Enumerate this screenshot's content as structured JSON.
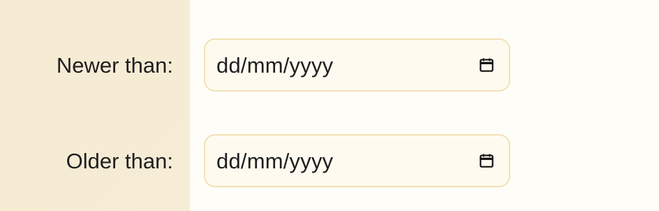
{
  "filters": {
    "newer": {
      "label": "Newer than:",
      "placeholder": "dd/mm/yyyy",
      "icon": "calendar-icon"
    },
    "older": {
      "label": "Older than:",
      "placeholder": "dd/mm/yyyy",
      "icon": "calendar-icon"
    }
  },
  "colors": {
    "left_panel_bg": "#f5ead2",
    "right_panel_bg": "#fffdf8",
    "input_bg": "#fffaf0",
    "input_border": "#f2e1b3",
    "text": "#1f1f1f"
  }
}
